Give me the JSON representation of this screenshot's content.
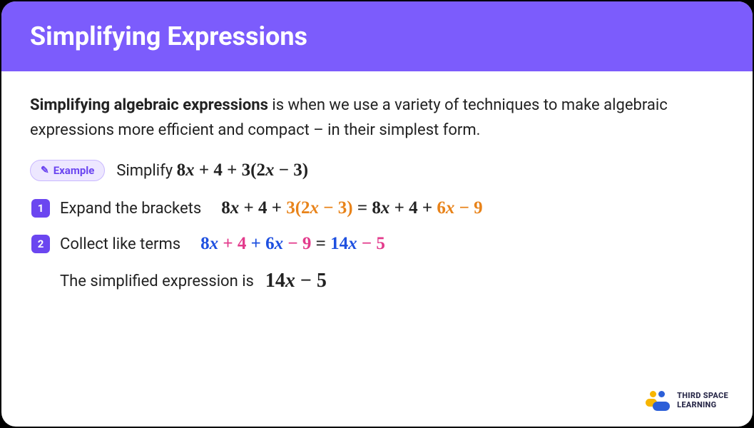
{
  "header": {
    "title": "Simplifying Expressions"
  },
  "intro": {
    "bold": "Simplifying algebraic expressions",
    "rest": " is when we use a variety of techniques to make algebraic expressions more efficient and compact – in their simplest form."
  },
  "example": {
    "pill_label": "Example",
    "lead": "Simplify ",
    "expr_before": "8",
    "expr_var1": "x",
    "expr_mid1": " + 4 + 3(2",
    "expr_var2": "x",
    "expr_mid2": " − 3)"
  },
  "steps": [
    {
      "num": "1",
      "label": "Expand the brackets",
      "lhs_a": "8",
      "lhs_v1": "x",
      "lhs_b": " + 4 + ",
      "or_a": "3(2",
      "or_v": "x",
      "or_b": " − 3)",
      "eq": " = ",
      "rhs_a": "8",
      "rhs_v1": "x",
      "rhs_b": " + 4 + ",
      "or2_a": "6",
      "or2_v": "x",
      "or2_b": " − 9"
    },
    {
      "num": "2",
      "label": "Collect like terms",
      "bl_a": "8",
      "bl_v": "x",
      "pk_a": " + 4",
      "bl2_a": " + 6",
      "bl2_v": "x",
      "pk2_a": " − 9",
      "eq": " = ",
      "res_bl_a": "14",
      "res_bl_v": "x",
      "res_pk": " − 5"
    }
  ],
  "result": {
    "label": "The simplified expression is",
    "a": "14",
    "v": "x",
    "b": " − 5"
  },
  "brand": {
    "line1": "THIRD SPACE",
    "line2": "LEARNING"
  }
}
